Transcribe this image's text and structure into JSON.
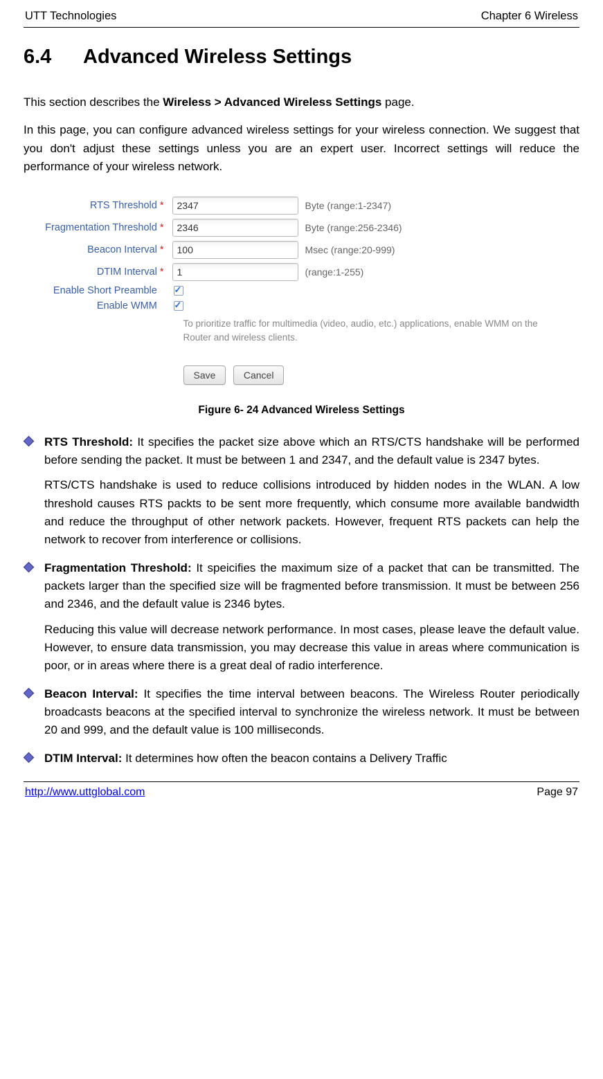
{
  "header": {
    "left": "UTT Technologies",
    "right": "Chapter 6 Wireless"
  },
  "heading": {
    "number": "6.4",
    "title": "Advanced Wireless Settings"
  },
  "intro": {
    "prefix": "This section describes the ",
    "bold": "Wireless > Advanced Wireless Settings",
    "suffix": " page."
  },
  "desc": "In this page, you can configure advanced wireless settings for your wireless connection. We suggest that you don't adjust these settings unless you are an expert user. Incorrect settings will reduce the performance of your wireless network.",
  "form": {
    "rts": {
      "label": "RTS Threshold",
      "value": "2347",
      "hint": "Byte (range:1-2347)"
    },
    "frag": {
      "label": "Fragmentation Threshold",
      "value": "2346",
      "hint": "Byte (range:256-2346)"
    },
    "beacon": {
      "label": "Beacon Interval",
      "value": "100",
      "hint": "Msec (range:20-999)"
    },
    "dtim": {
      "label": "DTIM Interval",
      "value": "1",
      "hint": "(range:1-255)"
    },
    "preamble_label": "Enable Short Preamble",
    "wmm_label": "Enable WMM",
    "wmm_note": "To prioritize traffic for multimedia (video, audio, etc.) applications, enable WMM on the Router and wireless clients.",
    "save": "Save",
    "cancel": "Cancel"
  },
  "figure_caption": "Figure 6- 24 Advanced Wireless Settings",
  "bullets": {
    "rts": {
      "title": "RTS Threshold:",
      "p1": " It specifies the packet size above which an RTS/CTS handshake will be performed before sending the packet. It must be between 1 and 2347, and the default value is 2347 bytes.",
      "p2": "RTS/CTS handshake is used to reduce collisions introduced by hidden nodes in the WLAN. A low threshold causes RTS packts to be sent more frequently, which consume more available bandwidth and reduce the throughput of other network packets. However, frequent RTS packets can help the network to recover from interference or collisions."
    },
    "frag": {
      "title": "Fragmentation Threshold:",
      "p1": " It speicifies the maximum size of a packet that can be transmitted. The packets larger than the specified size will be fragmented before transmission. It must be between 256 and 2346, and the default value is 2346 bytes.",
      "p2": "Reducing this value will decrease network performance. In most cases, please leave the default value. However, to ensure data transmission, you may decrease this value in areas where communication is poor, or in areas where there is a great deal of radio interference."
    },
    "beacon": {
      "title": "Beacon Interval:",
      "p1": " It specifies the time interval between beacons. The Wireless Router periodically broadcasts beacons at the specified interval to synchronize the wireless network. It must be between 20 and 999, and the default value is 100 milliseconds."
    },
    "dtim": {
      "title": "DTIM Interval:",
      "p1": " It determines how often the beacon contains a Delivery Traffic"
    }
  },
  "footer": {
    "url": "http://www.uttglobal.com",
    "page": "Page 97"
  }
}
